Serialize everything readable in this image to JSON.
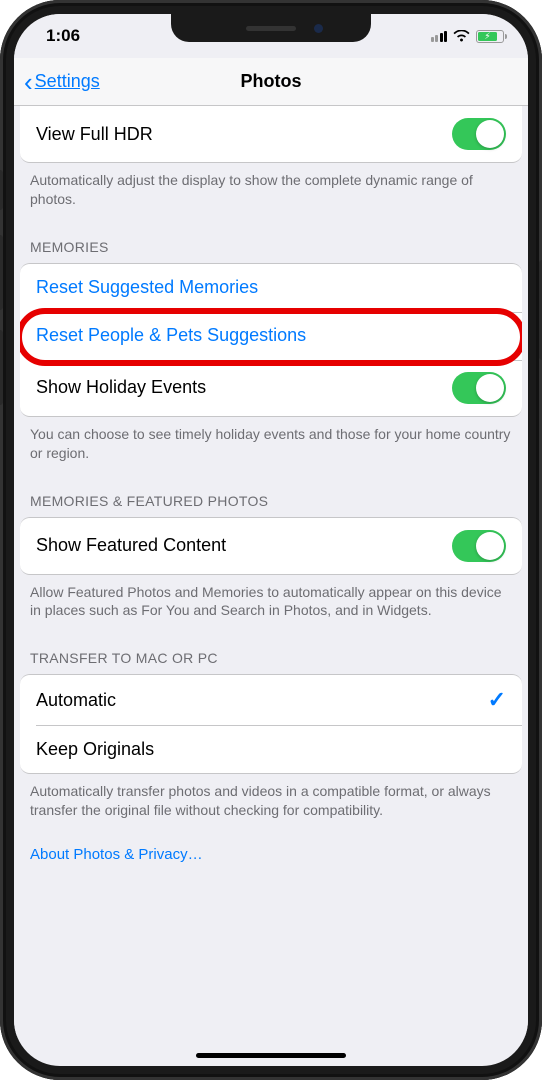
{
  "status_bar": {
    "time": "1:06"
  },
  "nav": {
    "back_label": "Settings",
    "title": "Photos"
  },
  "hdr": {
    "label": "View Full HDR",
    "toggle_on": true,
    "footer": "Automatically adjust the display to show the complete dynamic range of photos."
  },
  "memories": {
    "header": "MEMORIES",
    "reset_suggested": "Reset Suggested Memories",
    "reset_people_pets": "Reset People & Pets Suggestions",
    "show_holiday_label": "Show Holiday Events",
    "show_holiday_on": true,
    "footer": "You can choose to see timely holiday events and those for your home country or region."
  },
  "featured": {
    "header": "MEMORIES & FEATURED PHOTOS",
    "show_featured_label": "Show Featured Content",
    "show_featured_on": true,
    "footer": "Allow Featured Photos and Memories to automatically appear on this device in places such as For You and Search in Photos, and in Widgets."
  },
  "transfer": {
    "header": "TRANSFER TO MAC OR PC",
    "automatic": "Automatic",
    "keep_originals": "Keep Originals",
    "selected": "automatic",
    "footer": "Automatically transfer photos and videos in a compatible format, or always transfer the original file without checking for compatibility."
  },
  "about_link": "About Photos & Privacy…",
  "colors": {
    "accent": "#007aff",
    "toggle_on": "#34c759",
    "highlight": "#e60000"
  }
}
